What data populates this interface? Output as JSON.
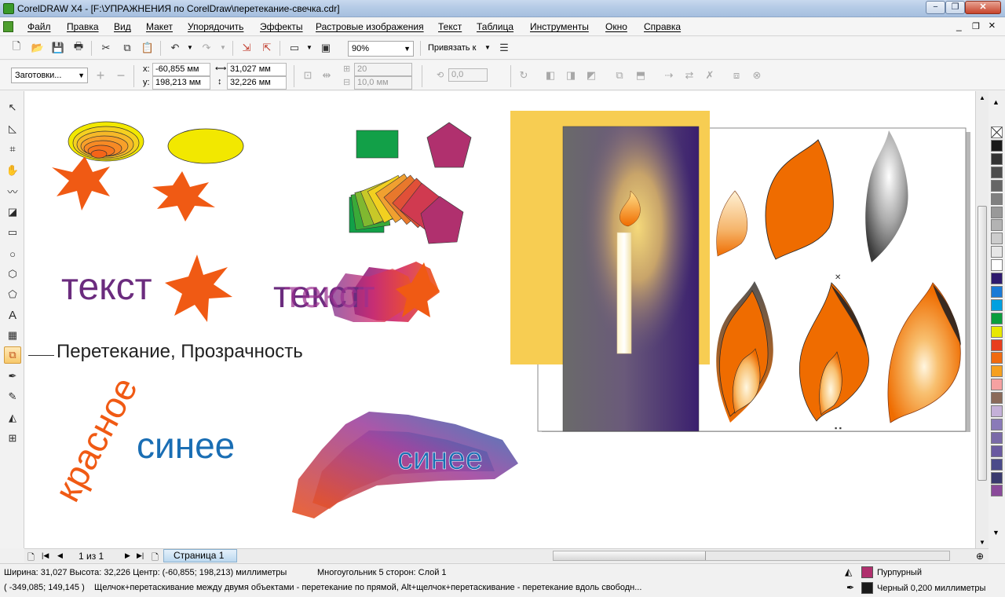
{
  "window": {
    "title": "CorelDRAW X4 - [F:\\УПРАЖНЕНИЯ по CorelDraw\\перетекание-свечка.cdr]",
    "btn_min": "−",
    "btn_restore": "❐",
    "btn_close": "✕",
    "doc_btn_min": "_",
    "doc_btn_restore": "❐",
    "doc_btn_close": "×"
  },
  "menu": {
    "items": [
      "Файл",
      "Правка",
      "Вид",
      "Макет",
      "Упорядочить",
      "Эффекты",
      "Растровые изображения",
      "Текст",
      "Таблица",
      "Инструменты",
      "Окно",
      "Справка"
    ]
  },
  "toolbar1": {
    "zoom_value": "90%",
    "snap_label": "Привязать к"
  },
  "toolbar2": {
    "presets_value": "Заготовки...",
    "x_label": "x:",
    "x_value": "-60,855 мм",
    "y_label": "y:",
    "y_value": "198,213 мм",
    "width_value": "31,027 мм",
    "height_value": "32,226 мм",
    "sides_value": "20",
    "offset_value": "10,0 мм",
    "angle_value": "0,0"
  },
  "canvas": {
    "callout": "Перетекание, Прозрачность",
    "text_tekst": "текст",
    "text_blend": "текст",
    "text_krasnoe": "красное",
    "text_sinee": "синее",
    "text_blend_sinee": "синее"
  },
  "pagebar": {
    "page_count": "1 из 1",
    "page_tab": "Страница 1"
  },
  "status": {
    "dims": "Ширина: 31,027 Высота: 32,226 Центр: (-60,855; 198,213) миллиметры",
    "object_info": "Многоугольник  5 сторон: Слой 1",
    "cursor": "( -349,085; 149,145 )",
    "hint": "Щелчок+перетаскивание между двумя объектами - перетекание по прямой, Alt+щелчок+перетаскивание - перетекание вдоль свободн...",
    "fill_name": "Пурпурный",
    "fill_color": "#b0306e",
    "outline_name": "Черный  0,200 миллиметры",
    "outline_color": "#1a1a1a"
  },
  "colors": {
    "orange": "#f05a14",
    "flame": "#ef6c00",
    "purple": "#6b2c7e",
    "blue": "#1a6eb4",
    "yellow": "#f2e800",
    "green": "#12a048",
    "magenta": "#b0306e",
    "candle_bg": "#f7cd52"
  },
  "palette": [
    "#1a1a1a",
    "#333333",
    "#4d4d4d",
    "#666666",
    "#808080",
    "#999999",
    "#b3b3b3",
    "#cccccc",
    "#e6e6e6",
    "#ffffff",
    "#2e1a6e",
    "#1a7ad6",
    "#00a0e0",
    "#0a9e3c",
    "#e8e800",
    "#e83e1e",
    "#f06a10",
    "#f5a020",
    "#f5a1a1",
    "#8a6a5a",
    "#c4b0d8",
    "#8a7ab8",
    "#7a6aa8",
    "#6a5aa0",
    "#4a4a8a",
    "#3a3a6e",
    "#8a4a9a"
  ]
}
